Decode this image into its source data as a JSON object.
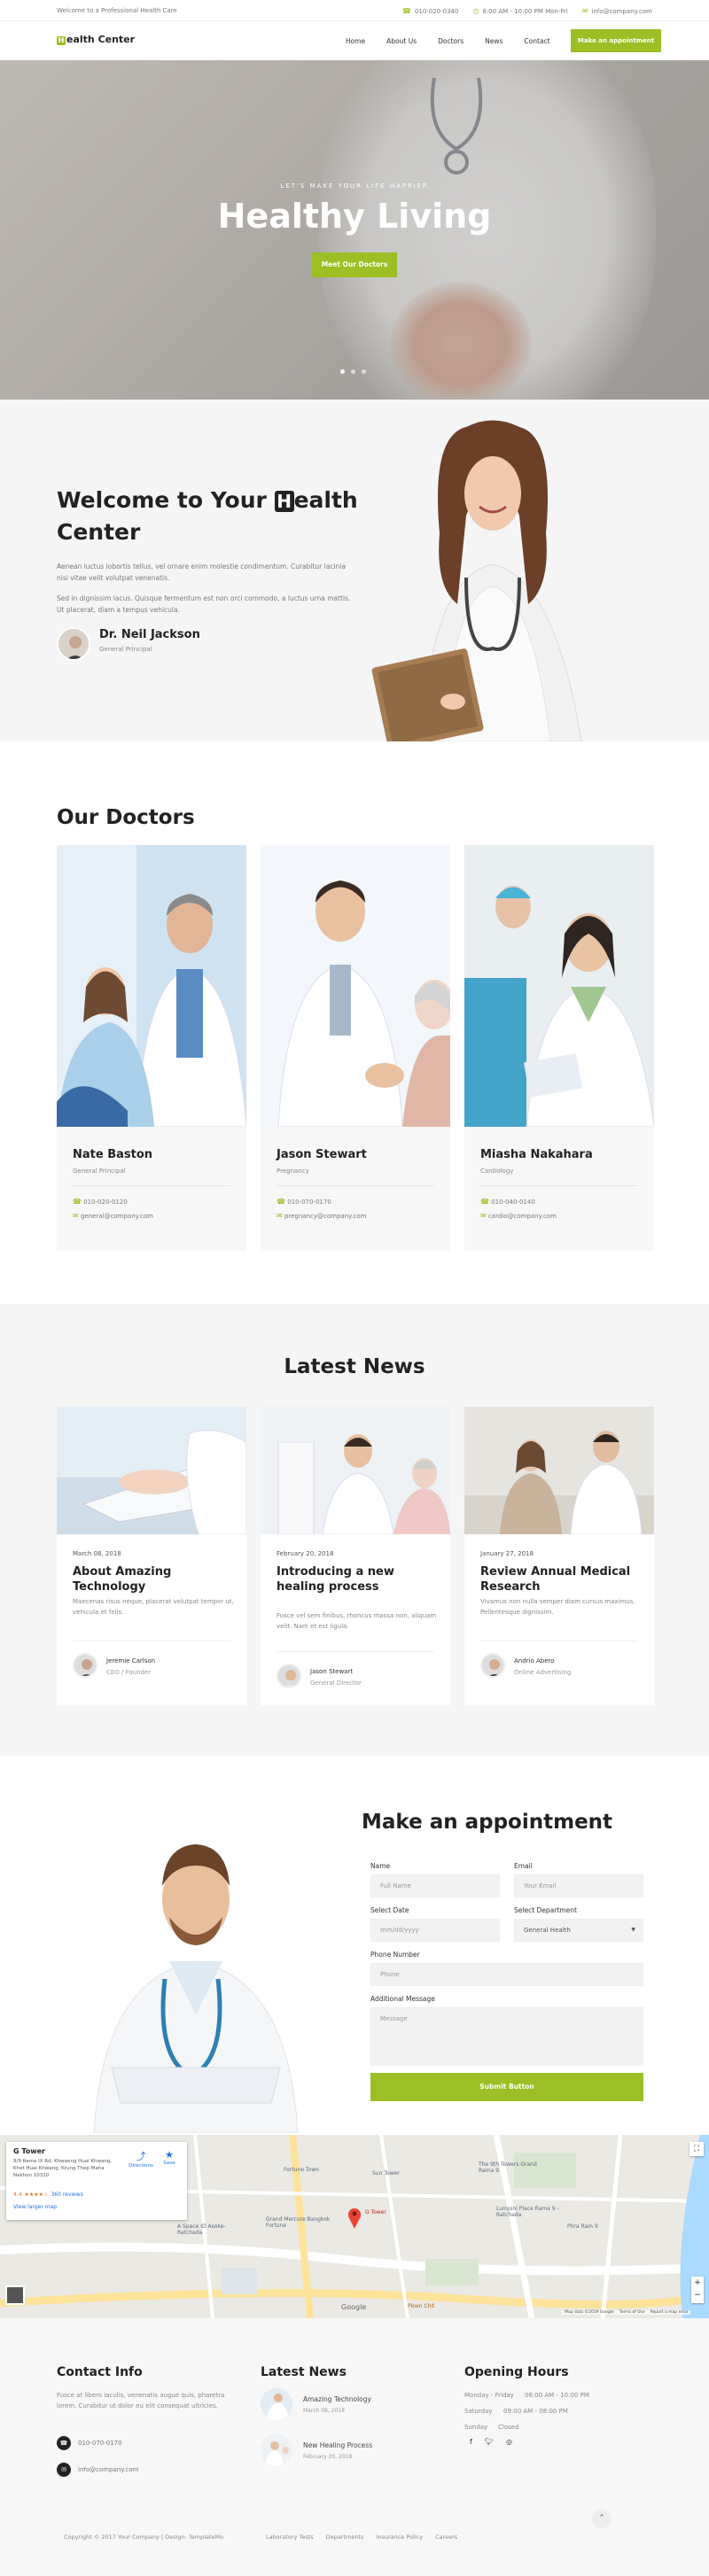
{
  "topbar": {
    "welcome": "Welcome to a Professional Health Care",
    "phone": "010-020-0340",
    "hours": "8:00 AM - 10:00 PM Mon-Fri",
    "email": "info@company.com"
  },
  "nav": {
    "logo_letter": "H",
    "logo_rest": "ealth Center",
    "items": [
      "Home",
      "About Us",
      "Doctors",
      "News",
      "Contact"
    ],
    "cta": "Make an appointment"
  },
  "hero": {
    "kicker": "LET'S MAKE YOUR LIFE HAPPIER",
    "title": "Healthy Living",
    "button": "Meet Our Doctors",
    "slide_count": 3,
    "active_slide": 1
  },
  "welcome": {
    "title_pre": "Welcome to Your ",
    "title_letter": "H",
    "title_post": "ealth Center",
    "p1": "Aenean luctus lobortis tellus, vel ornare enim molestie condimentum. Curabitur lacinia nisi vitae velit volutpat venenatis.",
    "p2": "Sed in dignissim lacus. Quisque fermentum est non orci commodo, a luctus urna mattis. Ut placerat, diam a tempus vehicula.",
    "name": "Dr. Neil Jackson",
    "role": "General Principal"
  },
  "doctors": {
    "title": "Our Doctors",
    "items": [
      {
        "name": "Nate Baston",
        "role": "General Principal",
        "phone": "010-020-0120",
        "email": "general@company.com"
      },
      {
        "name": "Jason Stewart",
        "role": "Pregnancy",
        "phone": "010-070-0170",
        "email": "pregnancy@company.com"
      },
      {
        "name": "Miasha Nakahara",
        "role": "Cardiology",
        "phone": "010-040-0140",
        "email": "cardio@company.com"
      }
    ]
  },
  "news": {
    "title": "Latest News",
    "items": [
      {
        "date": "March 08, 2018",
        "title": "About Amazing Technology",
        "desc": "Maecenas risus neque, placerat volutpat tempor ut, vehicula et felis.",
        "author": "Jeremie Carlson",
        "author_role": "CEO / Founder"
      },
      {
        "date": "February 20, 2018",
        "title": "Introducing a new healing process",
        "desc": "Fusce vel sem finibus, rhoncus massa non, aliquam velit. Nam et est ligula.",
        "author": "Jason Stewart",
        "author_role": "General Director"
      },
      {
        "date": "January 27, 2018",
        "title": "Review Annual Medical Research",
        "desc": "Vivamus non nulla semper diam cursus maximus. Pellentesque dignissim.",
        "author": "Andrio Abero",
        "author_role": "Online Advertising"
      }
    ]
  },
  "appointment": {
    "title": "Make an appointment",
    "name_label": "Name",
    "name_ph": "Full Name",
    "email_label": "Email",
    "email_ph": "Your Email",
    "date_label": "Select Date",
    "date_ph": "mm/dd/yyyy",
    "dept_label": "Select Department",
    "dept_value": "General Health",
    "phone_label": "Phone Number",
    "phone_ph": "Phone",
    "msg_label": "Additional Message",
    "msg_ph": "Message",
    "submit": "Submit Button"
  },
  "map": {
    "place": "G Tower",
    "address": "9/9 Rama IX Rd, Khwaeng Huai Khwang, Khet Huai Khwang, Krung Thep Maha Nakhon 10310",
    "rating": "4.4",
    "reviews": "360 reviews",
    "larger": "View larger map",
    "directions": "Directions",
    "save": "Save",
    "labels": [
      "The 9th Towers Grand Rama 9",
      "G Tower",
      "Fortune Town",
      "A Space ID Asoke-Ratchada",
      "Grand Mercure Bangkok Fortune",
      "Lumpini Place Rama 9 - Ratchada",
      "Phra Ram 9",
      "Sun Tower",
      "Ploen Chit"
    ],
    "google": "Google",
    "map_data": "Map data ©2019 Google",
    "terms": "Terms of Use",
    "report": "Report a map error"
  },
  "footer": {
    "contact_title": "Contact Info",
    "contact_text": "Fusce at libero iaculis, venenatis augue quis, pharetra lorem. Curabitur ut dolor eu elit consequat ultricies.",
    "phone": "010-070-0170",
    "email": "info@company.com",
    "news_title": "Latest News",
    "news_items": [
      {
        "title": "Amazing Technology",
        "date": "March 08, 2018"
      },
      {
        "title": "New Healing Process",
        "date": "February 20, 2018"
      }
    ],
    "hours_title": "Opening Hours",
    "hours": [
      {
        "day": "Monday - Friday",
        "time": "06:00 AM - 10:00 PM"
      },
      {
        "day": "Saturday",
        "time": "09:00 AM - 08:00 PM"
      },
      {
        "day": "Sunday",
        "time": "Closed"
      }
    ],
    "copyright": "Copyright © 2017 Your Company | Design: TemplateMo",
    "links": [
      "Laboratory Tests",
      "Departments",
      "Insurance Policy",
      "Careers"
    ]
  },
  "colors": {
    "accent": "#9bbf24",
    "dark": "#222222",
    "muted": "#888888"
  }
}
